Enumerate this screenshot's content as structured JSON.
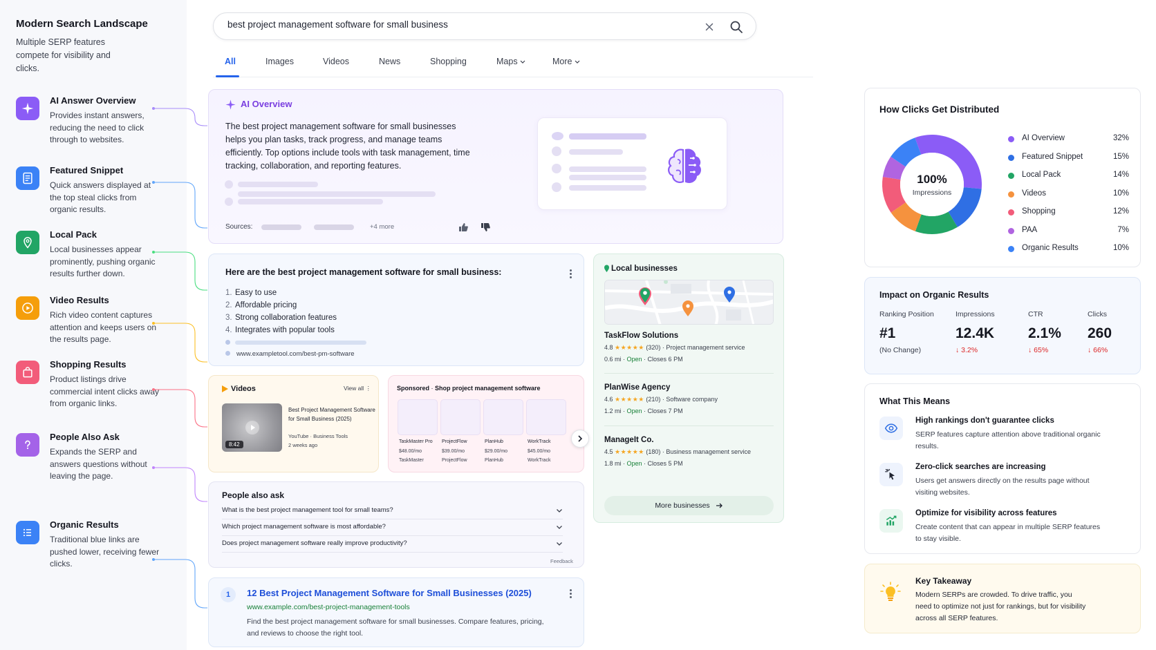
{
  "left": {
    "title": "Modern Search Landscape",
    "subtitle": "Multiple SERP features compete for visibility and clicks.",
    "features": [
      {
        "name": "AI Answer Overview",
        "desc": "Provides instant answers, reducing the need to click through to websites.",
        "color": "#8b5cf6",
        "icon": "sparkle-icon"
      },
      {
        "name": "Featured Snippet",
        "desc": "Quick answers displayed at the top steal clicks from organic results.",
        "color": "#3b82f6",
        "icon": "document-icon"
      },
      {
        "name": "Local Pack",
        "desc": "Local businesses appear prominently, pushing organic results further down.",
        "color": "#22a565",
        "icon": "map-pin-icon"
      },
      {
        "name": "Video Results",
        "desc": "Rich video content captures attention and keeps users on the results page.",
        "color": "#f59e0b",
        "icon": "play-icon"
      },
      {
        "name": "Shopping Results",
        "desc": "Product listings drive commercial intent clicks away from organic links.",
        "color": "#f25c7a",
        "icon": "shopping-bag-icon"
      },
      {
        "name": "People Also Ask",
        "desc": "Expands the SERP and answers questions without leaving the page.",
        "color": "#a463e8",
        "icon": "question-icon"
      },
      {
        "name": "Organic Results",
        "desc": "Traditional blue links are pushed lower, receiving fewer clicks.",
        "color": "#3b82f6",
        "icon": "list-icon"
      }
    ]
  },
  "search": {
    "query": "best project management software for small business",
    "tabs": [
      "All",
      "Images",
      "Videos",
      "News",
      "Shopping",
      "Maps",
      "More"
    ]
  },
  "ai": {
    "heading": "AI Overview",
    "text": "The best project management software for small businesses helps you plan tasks, track progress, and manage teams efficiently. Top options include tools with task management, time tracking, collaboration, and reporting features.",
    "sources_label": "Sources:",
    "more_sources": "+4 more"
  },
  "snippet": {
    "title": "Here are the best project management software for small business:",
    "items": [
      "Easy to use",
      "Affordable pricing",
      "Strong collaboration features",
      "Integrates with popular tools"
    ],
    "url": "www.exampletool.com/best-pm-software"
  },
  "videos": {
    "heading": "Videos",
    "view_all": "View all",
    "duration": "8:42",
    "title": "Best Project Management Software for Small Business (2025)",
    "channel": "YouTube · Business Tools",
    "age": "2 weeks ago"
  },
  "shopping": {
    "sponsored": "Sponsored",
    "heading": "Shop project management software",
    "products": [
      {
        "name": "TaskMaster Pro",
        "price": "$48.00/mo",
        "store": "TaskMaster"
      },
      {
        "name": "ProjectFlow",
        "price": "$39.00/mo",
        "store": "ProjectFlow"
      },
      {
        "name": "PlanHub",
        "price": "$29.00/mo",
        "store": "PlanHub"
      },
      {
        "name": "WorkTrack",
        "price": "$45.00/mo",
        "store": "WorkTrack"
      }
    ]
  },
  "paa": {
    "title": "People also ask",
    "questions": [
      "What is the best project management tool for small teams?",
      "Which project management software is most affordable?",
      "Does project management software really improve productivity?"
    ],
    "feedback": "Feedback"
  },
  "organic": {
    "rank": "1",
    "title": "12 Best Project Management Software for Small Businesses (2025)",
    "url": "www.example.com/best-project-management-tools",
    "desc": "Find the best project management software for small businesses. Compare features, pricing, and reviews to choose the right tool."
  },
  "local": {
    "heading": "Local businesses",
    "businesses": [
      {
        "name": "TaskFlow Solutions",
        "rating": "4.8",
        "stars": "★★★★★",
        "reviews": "(320)",
        "type": "Project management service",
        "distance": "0.6 mi",
        "status": "Open",
        "closes": "Closes 6 PM"
      },
      {
        "name": "PlanWise Agency",
        "rating": "4.6",
        "stars": "★★★★★",
        "reviews": "(210)",
        "type": "Software company",
        "distance": "1.2 mi",
        "status": "Open",
        "closes": "Closes 7 PM"
      },
      {
        "name": "ManageIt Co.",
        "rating": "4.5",
        "stars": "★★★★★",
        "reviews": "(180)",
        "type": "Business management service",
        "distance": "1.8 mi",
        "status": "Open",
        "closes": "Closes 5 PM"
      }
    ],
    "more": "More businesses"
  },
  "chart_data": {
    "type": "pie",
    "title": "How Clicks Get Distributed",
    "center_value": "100%",
    "center_label": "Impressions",
    "categories": [
      "AI Overview",
      "Featured Snippet",
      "Local Pack",
      "Videos",
      "Shopping",
      "PAA",
      "Organic Results"
    ],
    "values": [
      32,
      15,
      14,
      10,
      12,
      7,
      10
    ],
    "labels": [
      "32%",
      "15%",
      "14%",
      "10%",
      "12%",
      "7%",
      "10%"
    ],
    "colors": [
      "#8b5cf6",
      "#2f6fe4",
      "#22a565",
      "#f5923e",
      "#f25c7a",
      "#b064e0",
      "#3b82f6"
    ]
  },
  "impact": {
    "title": "Impact on Organic Results",
    "metrics": [
      {
        "label": "Ranking Position",
        "value": "#1",
        "sub": "(No Change)"
      },
      {
        "label": "Impressions",
        "value": "12.4K",
        "sub": "↓ 3.2%"
      },
      {
        "label": "CTR",
        "value": "2.1%",
        "sub": "↓ 65%"
      },
      {
        "label": "Clicks",
        "value": "260",
        "sub": "↓ 66%"
      }
    ]
  },
  "means": {
    "title": "What This Means",
    "items": [
      {
        "heading": "High rankings don't guarantee clicks",
        "text": "SERP features capture attention above traditional organic results.",
        "icon": "eye-icon"
      },
      {
        "heading": "Zero-click searches are increasing",
        "text": "Users get answers directly on the results page without visiting websites.",
        "icon": "cursor-click-icon"
      },
      {
        "heading": "Optimize for visibility across features",
        "text": "Create content that can appear in multiple SERP features to stay visible.",
        "icon": "growth-chart-icon"
      }
    ]
  },
  "takeaway": {
    "heading": "Key Takeaway",
    "text": "Modern SERPs are crowded. To drive traffic, you need to optimize not just for rankings, but for visibility across all SERP features."
  }
}
